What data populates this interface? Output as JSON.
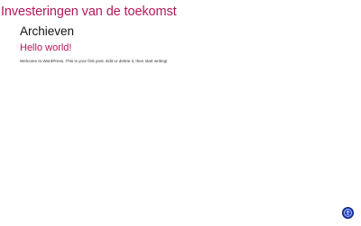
{
  "site": {
    "title": "Investeringen van de toekomst"
  },
  "archive": {
    "heading": "Archieven"
  },
  "posts": [
    {
      "title": "Hello world!",
      "excerpt": "Welcome to WordPress. This is your first post. Edit or delete it, then start writing!"
    }
  ],
  "widgets": {
    "accessibility_icon": "accessibility-icon",
    "accent_color": "#1f45c9"
  },
  "theme": {
    "accent": "#b5175c"
  }
}
